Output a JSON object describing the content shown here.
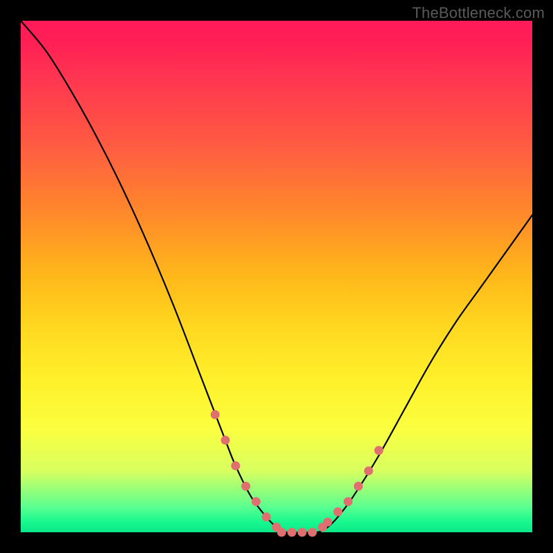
{
  "watermark": "TheBottleneck.com",
  "chart_data": {
    "type": "line",
    "title": "",
    "xlabel": "",
    "ylabel": "",
    "xlim": [
      0,
      100
    ],
    "ylim": [
      0,
      100
    ],
    "grid": false,
    "legend": false,
    "series": [
      {
        "name": "bottleneck-curve",
        "x": [
          0,
          5,
          10,
          15,
          20,
          25,
          30,
          35,
          40,
          42,
          45,
          48,
          50,
          52,
          55,
          58,
          60,
          62,
          65,
          70,
          75,
          80,
          85,
          90,
          95,
          100
        ],
        "values": [
          100,
          94,
          86,
          77,
          67,
          56,
          44,
          31,
          18,
          13,
          7,
          3,
          1,
          0,
          0,
          0,
          1,
          3,
          7,
          15,
          24,
          33,
          41,
          48,
          55,
          62
        ]
      }
    ],
    "dots": {
      "name": "sample-points",
      "color": "#e07070",
      "x": [
        38,
        40,
        42,
        44,
        46,
        48,
        50,
        51,
        53,
        55,
        57,
        59,
        60,
        62,
        64,
        66,
        68,
        70
      ],
      "values": [
        23,
        18,
        13,
        9,
        6,
        3,
        1,
        0,
        0,
        0,
        0,
        1,
        2,
        4,
        6,
        9,
        12,
        16
      ]
    }
  }
}
